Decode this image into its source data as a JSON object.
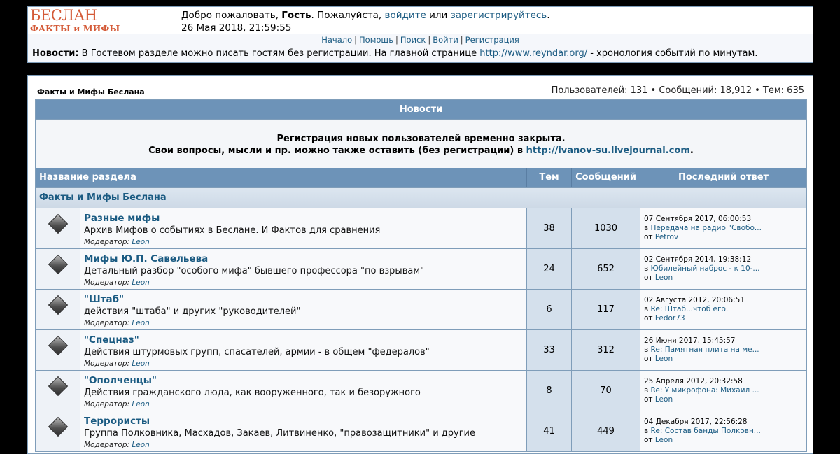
{
  "logo": {
    "line1": "БЕСЛАН",
    "line2": "ФАКТЫ и МИФЫ"
  },
  "welcome": {
    "prefix": "Добро пожаловать, ",
    "guest": "Гость",
    "mid": ". Пожалуйста, ",
    "login": "войдите",
    "or": " или ",
    "register": "зарегистрируйтесь",
    "suffix": ".",
    "datetime": "26 Мая 2018, 21:59:55"
  },
  "nav": [
    "Начало",
    "Помощь",
    "Поиск",
    "Войти",
    "Регистрация"
  ],
  "news": {
    "label": "Новости:",
    "text": " В Гостевом разделе можно писать гостям без регистрации. На главной странице ",
    "link": "http://www.reyndar.org/",
    "tail": " - хронология событий по минутам."
  },
  "forum_name": "Факты и Мифы Беслана",
  "stats": "Пользователей: 131  •  Сообщений: 18,912  •  Тем: 635",
  "announce": {
    "header": "Новости",
    "line1": "Регистрация новых пользователей временно закрыта.",
    "line2": "Свои вопросы, мысли и пр. можно также оставить (без регистрации) в ",
    "link": "http://ivanov-su.livejournal.com",
    "tail": "."
  },
  "columns": {
    "section": "Название раздела",
    "topics": "Тем",
    "posts": "Сообщений",
    "last": "Последний ответ"
  },
  "category": "Факты и Мифы Беслана",
  "moderator_label": "Модератор: ",
  "in_label": "в ",
  "from_label": "от ",
  "boards": [
    {
      "title": "Разные мифы",
      "desc": "Архив Мифов о событиях в Беслане. И Фактов для сравнения",
      "moderator": "Leon",
      "topics": "38",
      "posts": "1030",
      "last_date": "07 Сентября 2017, 06:00:53",
      "last_topic": "Передача на радио \"Свобо...",
      "last_author": "Petrov"
    },
    {
      "title": "Мифы Ю.П. Савельева",
      "desc": "Детальный разбор \"особого мифа\" бывшего профессора \"по взрывам\"",
      "moderator": "Leon",
      "topics": "24",
      "posts": "652",
      "last_date": "02 Сентября 2014, 19:38:12",
      "last_topic": "Юбилейный наброс - к 10-...",
      "last_author": "Leon"
    },
    {
      "title": "\"Штаб\"",
      "desc": "действия \"штаба\" и других \"руководителей\"",
      "moderator": "Leon",
      "topics": "6",
      "posts": "117",
      "last_date": "02 Августа 2012, 20:06:51",
      "last_topic": "Re: Штаб...чтоб его.",
      "last_author": "Fedor73"
    },
    {
      "title": "\"Спецназ\"",
      "desc": "Действия штурмовых групп, спасателей, армии - в общем \"федералов\"",
      "moderator": "Leon",
      "topics": "33",
      "posts": "312",
      "last_date": "26 Июня 2017, 15:45:57",
      "last_topic": "Re: Памятная плита на ме...",
      "last_author": "Leon"
    },
    {
      "title": "\"Ополченцы\"",
      "desc": "Действия гражданского люда, как вооруженного, так и безоружного",
      "moderator": "Leon",
      "topics": "8",
      "posts": "70",
      "last_date": "25 Апреля 2012, 20:32:58",
      "last_topic": "Re: У микрофона: Михаил ...",
      "last_author": "Leon"
    },
    {
      "title": "Террористы",
      "desc": "Группа Полковника, Масхадов, Закаев, Литвиненко, \"правозащитники\" и другие",
      "moderator": "Leon",
      "topics": "41",
      "posts": "449",
      "last_date": "04 Декабря 2017, 22:56:28",
      "last_topic": "Re: Состав банды Полковн...",
      "last_author": "Leon"
    }
  ]
}
